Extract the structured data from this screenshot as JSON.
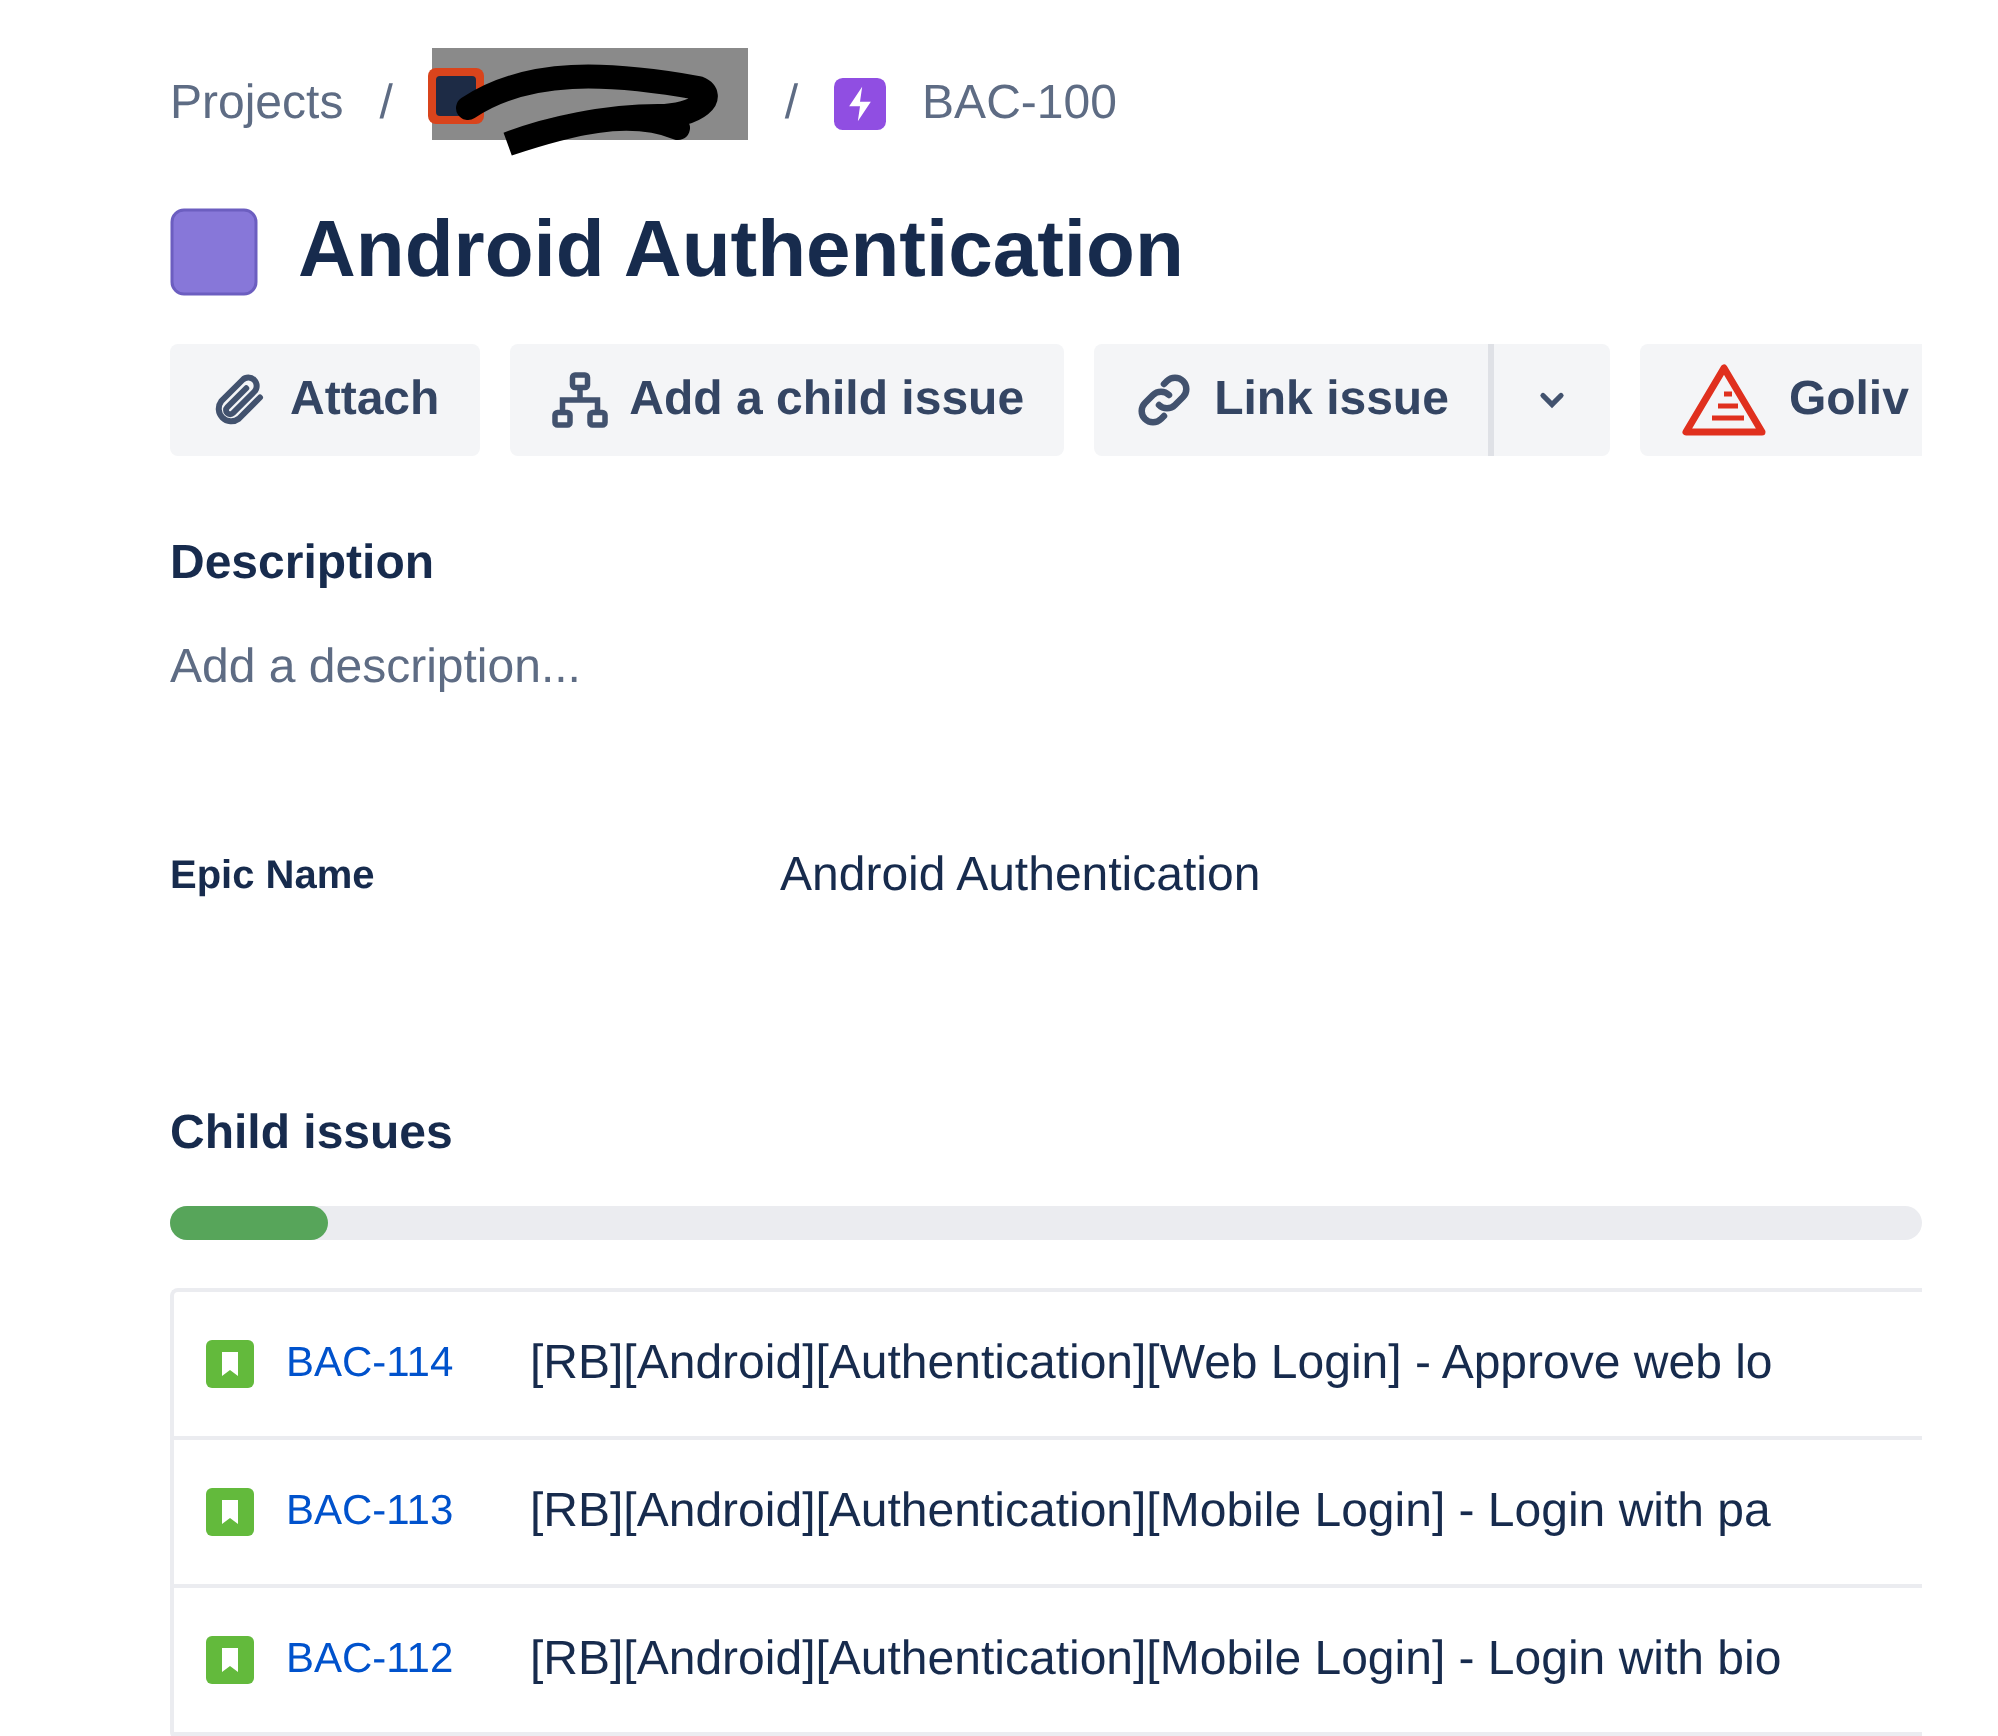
{
  "breadcrumbs": {
    "root": "Projects",
    "separators": [
      "/",
      "/"
    ],
    "issue_key": "BAC-100"
  },
  "title": "Android Authentication",
  "actions": [
    {
      "kind": "attach",
      "label": "Attach"
    },
    {
      "kind": "child",
      "label": "Add a child issue"
    },
    {
      "kind": "link",
      "label": "Link issue"
    },
    {
      "kind": "menu"
    },
    {
      "kind": "app",
      "label": "Goliv"
    }
  ],
  "description": {
    "heading": "Description",
    "placeholder": "Add a description..."
  },
  "fields": [
    {
      "label": "Epic Name",
      "value": "Android Authentication"
    }
  ],
  "child_issues": {
    "heading": "Child issues",
    "level": 0.09,
    "rows": [
      {
        "key": "BAC-114",
        "summary": "[RB][Android][Authentication][Web Login] - Approve web lo"
      },
      {
        "key": "BAC-113",
        "summary": "[RB][Android][Authentication][Mobile Login] - Login with pa"
      },
      {
        "key": "BAC-112",
        "summary": "[RB][Android][Authentication][Mobile Login] - Login with bio"
      }
    ]
  }
}
